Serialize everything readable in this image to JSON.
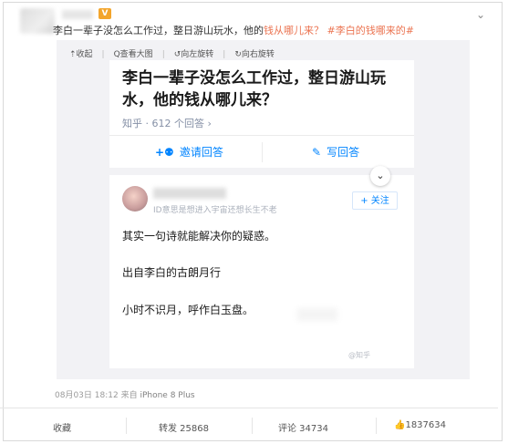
{
  "post": {
    "verified_badge": "V",
    "dropdown_icon": "chevron-down-icon",
    "text_main": "李白一辈子没怎么工作过，整日游山玩水，他的",
    "text_highlight": "钱从哪儿来？",
    "text_hashtag": "#李白的钱哪来的#",
    "toolbar": {
      "collapse": "⇡收起",
      "view_large": "Q查看大图",
      "rotate_left": "↺向左旋转",
      "rotate_right": "↻向右旋转"
    },
    "meta_time": "08月03日 18:12",
    "meta_from": "来自",
    "meta_device": "iPhone 8 Plus",
    "actions": {
      "favorite": "收藏",
      "repost": "转发 25868",
      "comment": "评论 34734",
      "like": "1837634"
    }
  },
  "zhihu": {
    "title": "李白一辈子没怎么工作过，整日游山玩水，他的钱从哪儿来？",
    "meta": "知乎 · 612 个回答 ›",
    "invite_button": "邀请回答",
    "write_button": "写回答",
    "answer": {
      "subtitle": "ID意思是想进入宇宙还想长生不老",
      "follow_button": "+ 关注",
      "lines": [
        "其实一句诗就能解决你的疑惑。",
        "出自李白的古朗月行",
        "小时不识月，呼作白玉盘。"
      ],
      "watermark": "@知乎"
    }
  }
}
